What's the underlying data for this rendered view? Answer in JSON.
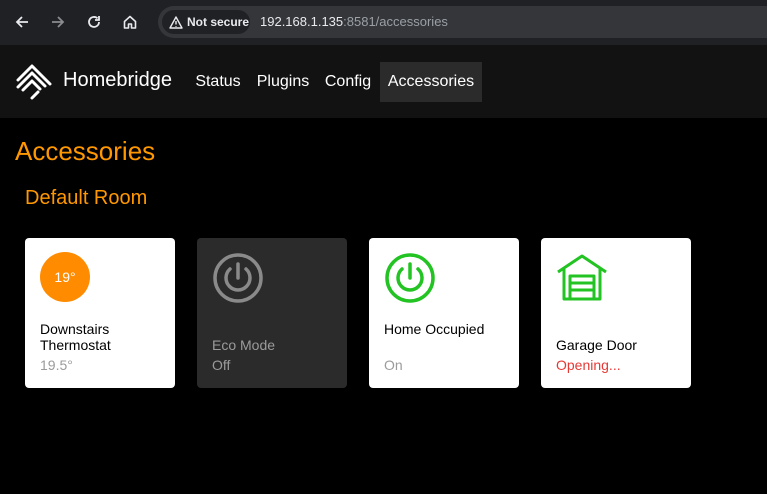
{
  "browser": {
    "security_label": "Not secure",
    "url_host": "192.168.1.135",
    "url_path": ":8581/accessories"
  },
  "navbar": {
    "brand": "Homebridge",
    "links": [
      {
        "label": "Status",
        "active": false
      },
      {
        "label": "Plugins",
        "active": false
      },
      {
        "label": "Config",
        "active": false
      },
      {
        "label": "Accessories",
        "active": true
      }
    ]
  },
  "page": {
    "title": "Accessories",
    "room": "Default Room"
  },
  "tiles": [
    {
      "name": "Downstairs Thermostat",
      "status": "19.5°",
      "badge": "19°",
      "icon": "thermostat-icon",
      "color": "#ff8c00"
    },
    {
      "name": "Eco Mode",
      "status": "Off",
      "icon": "power-icon",
      "color": "#8a8a8a"
    },
    {
      "name": "Home Occupied",
      "status": "On",
      "icon": "power-icon",
      "color": "#22c322"
    },
    {
      "name": "Garage Door",
      "status": "Opening...",
      "icon": "garage-door-icon",
      "color": "#22c322",
      "status_color": "#e53935"
    }
  ],
  "colors": {
    "accent": "#ff9800",
    "active_green": "#22c322"
  }
}
